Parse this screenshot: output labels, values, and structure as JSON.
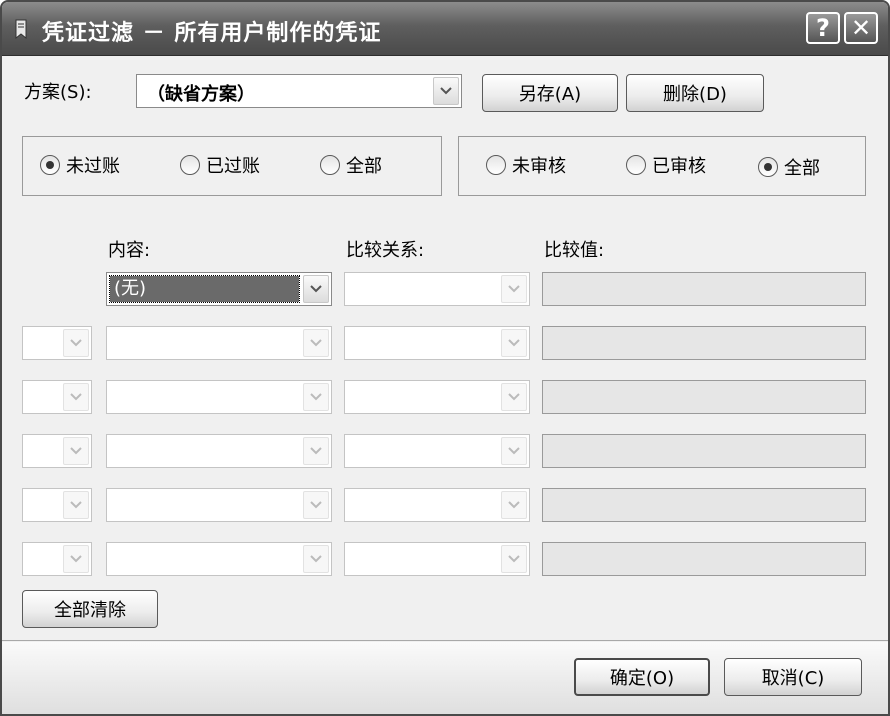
{
  "window": {
    "title": "凭证过滤 － 所有用户制作的凭证",
    "help_glyph": "?",
    "close_glyph": "✕"
  },
  "scheme": {
    "label": "方案(S):",
    "value": "（缺省方案）",
    "save_as_label": "另存(A)",
    "delete_label": "删除(D)"
  },
  "posting_filter": {
    "options": [
      "未过账",
      "已过账",
      "全部"
    ],
    "selected": "未过账"
  },
  "audit_filter": {
    "options": [
      "未审核",
      "已审核",
      "全部"
    ],
    "selected": "全部"
  },
  "conditions": {
    "headers": {
      "content": "内容:",
      "relation": "比较关系:",
      "value": "比较值:"
    },
    "first_row_content": "(无)",
    "extra_rows": 5
  },
  "clear_all_label": "全部清除",
  "footer": {
    "ok_label": "确定(O)",
    "cancel_label": "取消(C)"
  },
  "icons": {
    "title": "doc-filter-icon",
    "dropdown": "chevron-down-icon"
  },
  "colors": {
    "titlebar": "#5e5e5e",
    "dialog_bg": "#f0f0f0",
    "disabled_field": "#e6e6e6",
    "selection": "#6a6a6a"
  }
}
